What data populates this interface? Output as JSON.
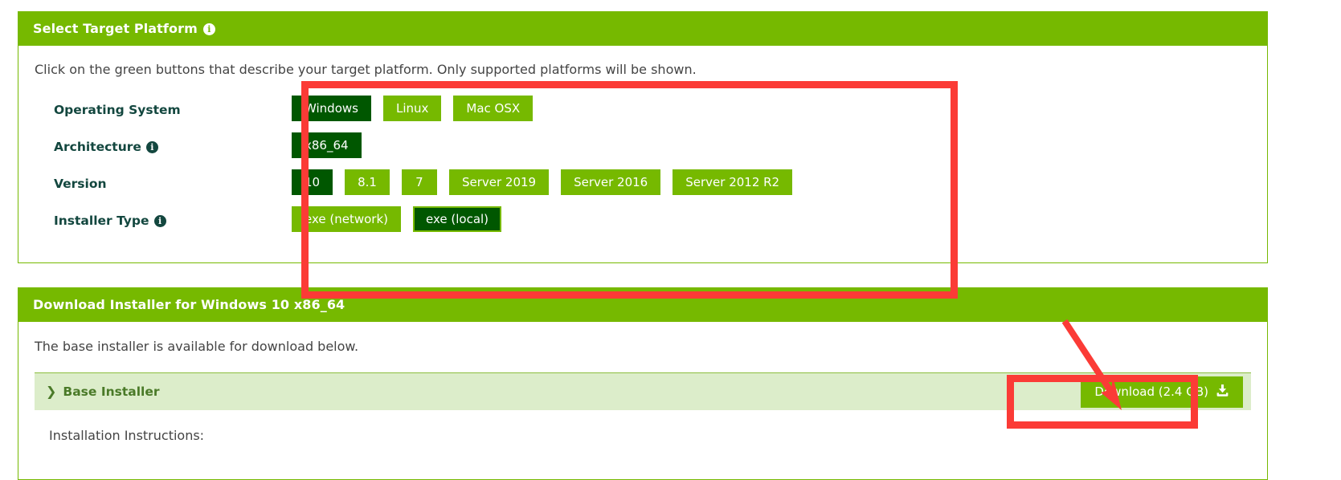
{
  "platform_card": {
    "header": {
      "title": "Select Target Platform",
      "info_icon": "i"
    },
    "intro": "Click on the green buttons that describe your target platform. Only supported platforms will be shown.",
    "rows": [
      {
        "label": "Operating System",
        "has_info": false,
        "info_icon": "i",
        "options": [
          {
            "label": "Windows",
            "selected": true
          },
          {
            "label": "Linux",
            "selected": false
          },
          {
            "label": "Mac OSX",
            "selected": false
          }
        ]
      },
      {
        "label": "Architecture",
        "has_info": true,
        "info_icon": "i",
        "options": [
          {
            "label": "x86_64",
            "selected": true
          }
        ]
      },
      {
        "label": "Version",
        "has_info": false,
        "info_icon": "i",
        "options": [
          {
            "label": "10",
            "selected": true
          },
          {
            "label": "8.1",
            "selected": false
          },
          {
            "label": "7",
            "selected": false
          },
          {
            "label": "Server 2019",
            "selected": false
          },
          {
            "label": "Server 2016",
            "selected": false
          },
          {
            "label": "Server 2012 R2",
            "selected": false
          }
        ]
      },
      {
        "label": "Installer Type",
        "has_info": true,
        "info_icon": "i",
        "options": [
          {
            "label": "exe (network)",
            "selected": false
          },
          {
            "label": "exe (local)",
            "selected": true,
            "outlined": true
          }
        ]
      }
    ]
  },
  "download_card": {
    "header": {
      "title": "Download Installer for Windows 10 x86_64"
    },
    "description": "The base installer is available for download below.",
    "installer": {
      "chevron": "❯",
      "name": "Base Installer",
      "download_label": "Download (2.4 GB)",
      "download_icon": "download-icon"
    },
    "instructions_heading": "Installation Instructions:"
  },
  "annotations": {
    "selector_highlight_box": "red-rectangle-around-platform-buttons",
    "download_highlight_box": "red-rectangle-around-download-button",
    "pointer_arrow": "red-arrow-pointing-to-download-button"
  },
  "colors": {
    "brand_green": "#76b900",
    "selected_green": "#005700",
    "dark_teal": "#13473f",
    "strip_green": "#dcedca",
    "annotation_red": "#fb3b36"
  }
}
